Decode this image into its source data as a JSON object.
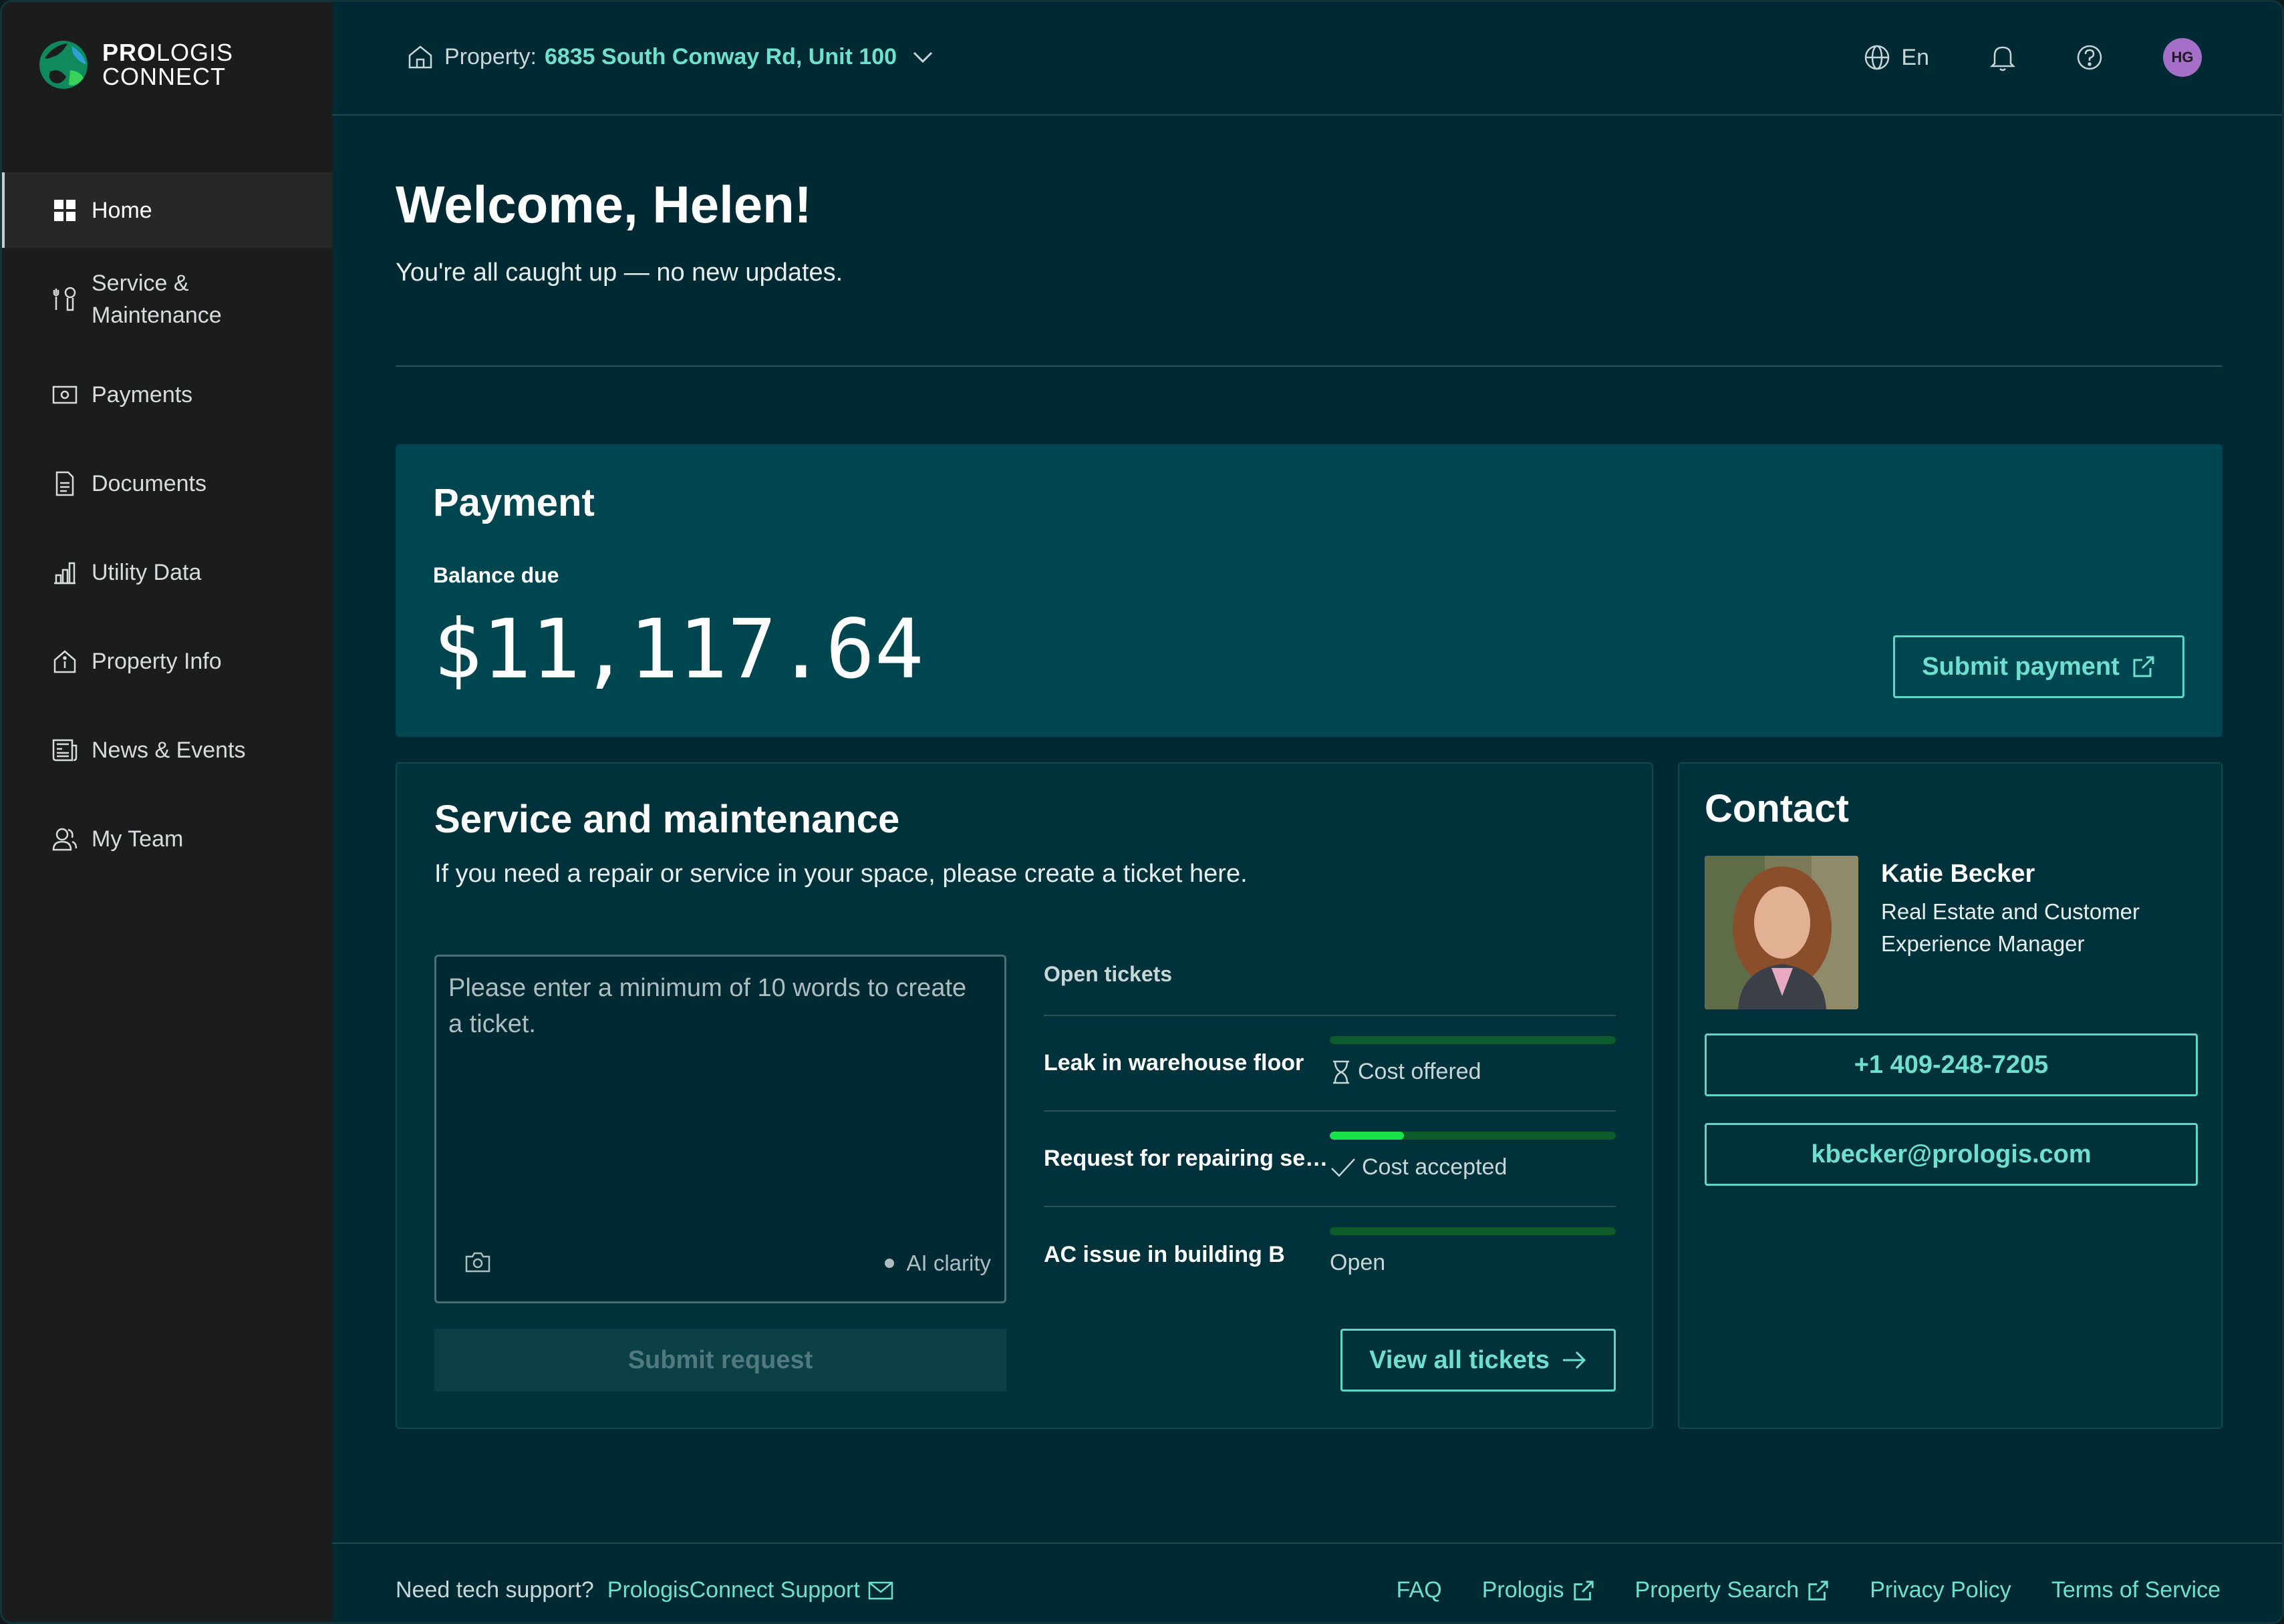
{
  "brand": {
    "logo_bold": "PRO",
    "logo_light": "LOGIS",
    "logo_line2": "CONNECT"
  },
  "sidebar": {
    "items": [
      {
        "label": "Home",
        "icon": "grid-icon",
        "active": true
      },
      {
        "label": "Service &\nMaintenance",
        "icon": "tools-icon"
      },
      {
        "label": "Payments",
        "icon": "cash-icon"
      },
      {
        "label": "Documents",
        "icon": "document-icon"
      },
      {
        "label": "Utility Data",
        "icon": "bar-chart-icon"
      },
      {
        "label": "Property Info",
        "icon": "house-info-icon"
      },
      {
        "label": "News & Events",
        "icon": "newspaper-icon"
      },
      {
        "label": "My Team",
        "icon": "team-icon"
      }
    ]
  },
  "header": {
    "property_label": "Property:",
    "property_value": "6835 South Conway Rd, Unit 100",
    "language": "En",
    "avatar_initials": "HG"
  },
  "welcome": {
    "title": "Welcome, Helen!",
    "subtitle": "You're all caught up — no new updates."
  },
  "payment": {
    "title": "Payment",
    "balance_label": "Balance due",
    "amount": "$11,117.64",
    "submit_label": "Submit payment"
  },
  "service": {
    "title": "Service and maintenance",
    "description": "If you need a repair or service in your space, please create a ticket here.",
    "placeholder": "Please enter a minimum of 10 words to create a ticket.",
    "ai_label": "AI clarity",
    "submit_label": "Submit request",
    "open_tickets_label": "Open tickets",
    "tickets": [
      {
        "name": "Leak in warehouse floor",
        "status": "Cost offered",
        "status_icon": "hourglass-icon",
        "progress": 0
      },
      {
        "name": "Request for repairing service",
        "status": "Cost accepted",
        "status_icon": "check-icon",
        "progress": 0.26
      },
      {
        "name": "AC issue in building B",
        "status": "Open",
        "status_icon": "",
        "progress": 0
      }
    ],
    "view_all_label": "View all tickets"
  },
  "contact": {
    "title": "Contact",
    "name": "Katie Becker",
    "role": "Real Estate and Customer Experience Manager",
    "phone": "+1 409-248-7205",
    "email": "kbecker@prologis.com"
  },
  "footer": {
    "support_prefix": "Need tech support?",
    "support_link": "PrologisConnect Support",
    "links": [
      "FAQ",
      "Prologis",
      "Property Search",
      "Privacy Policy",
      "Terms of Service"
    ]
  },
  "colors": {
    "accent": "#6fe0d0",
    "background": "#002a33",
    "sidebar": "#1b1c1e",
    "payment_card": "#004650",
    "progress": "#19e34a",
    "avatar": "#a56fc7"
  }
}
